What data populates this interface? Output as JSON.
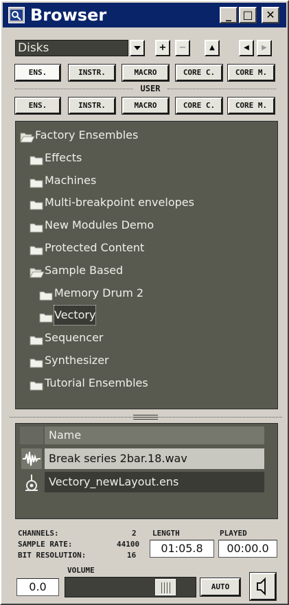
{
  "window": {
    "title": "Browser",
    "controls": {
      "minimize": "_",
      "maximize": "□",
      "close": "✕"
    }
  },
  "toolbar": {
    "source": "Disks",
    "add_label": "+",
    "remove_label": "−",
    "up_label": "▲",
    "back_label": "◀",
    "forward_label": "▶"
  },
  "factory_tabs": [
    {
      "label": "ENS.",
      "active": true
    },
    {
      "label": "INSTR."
    },
    {
      "label": "MACRO"
    },
    {
      "label": "CORE C."
    },
    {
      "label": "CORE M."
    }
  ],
  "user_section_label": "USER",
  "user_tabs": [
    {
      "label": "ENS."
    },
    {
      "label": "INSTR."
    },
    {
      "label": "MACRO"
    },
    {
      "label": "CORE C."
    },
    {
      "label": "CORE M."
    }
  ],
  "tree": [
    {
      "label": "Factory Ensembles",
      "level": 0,
      "open": true
    },
    {
      "label": "Effects",
      "level": 1
    },
    {
      "label": "Machines",
      "level": 1
    },
    {
      "label": "Multi-breakpoint envelopes",
      "level": 1
    },
    {
      "label": "New Modules Demo",
      "level": 1
    },
    {
      "label": "Protected Content",
      "level": 1
    },
    {
      "label": "Sample Based",
      "level": 1,
      "open": true
    },
    {
      "label": "Memory Drum 2",
      "level": 2
    },
    {
      "label": "Vectory",
      "level": 2,
      "selected": true
    },
    {
      "label": "Sequencer",
      "level": 1
    },
    {
      "label": "Synthesizer",
      "level": 1
    },
    {
      "label": "Tutorial Ensembles",
      "level": 1
    }
  ],
  "file_list": {
    "column_header": "Name",
    "rows": [
      {
        "name": "Break series 2bar.18.wav",
        "icon": "waveform-icon",
        "highlighted": true
      },
      {
        "name": "Vectory_newLayout.ens",
        "icon": "ensemble-icon"
      }
    ]
  },
  "file_info": {
    "channels_label": "CHANNELS:",
    "channels_value": "2",
    "sample_rate_label": "SAMPLE RATE:",
    "sample_rate_value": "44100",
    "bit_resolution_label": "BIT RESOLUTION:",
    "bit_resolution_value": "16",
    "length_label": "LENGTH",
    "length_value": "01:05.8",
    "played_label": "PLAYED",
    "played_value": "00:00.0"
  },
  "playback": {
    "volume_label": "VOLUME",
    "volume_value": "0.0",
    "volume_level": 0.82,
    "auto_label": "AUTO",
    "speaker_icon": "speaker-icon"
  },
  "colors": {
    "titlebar": "#0a246a",
    "panel": "#58594f",
    "chrome": "#d4d0c8"
  }
}
